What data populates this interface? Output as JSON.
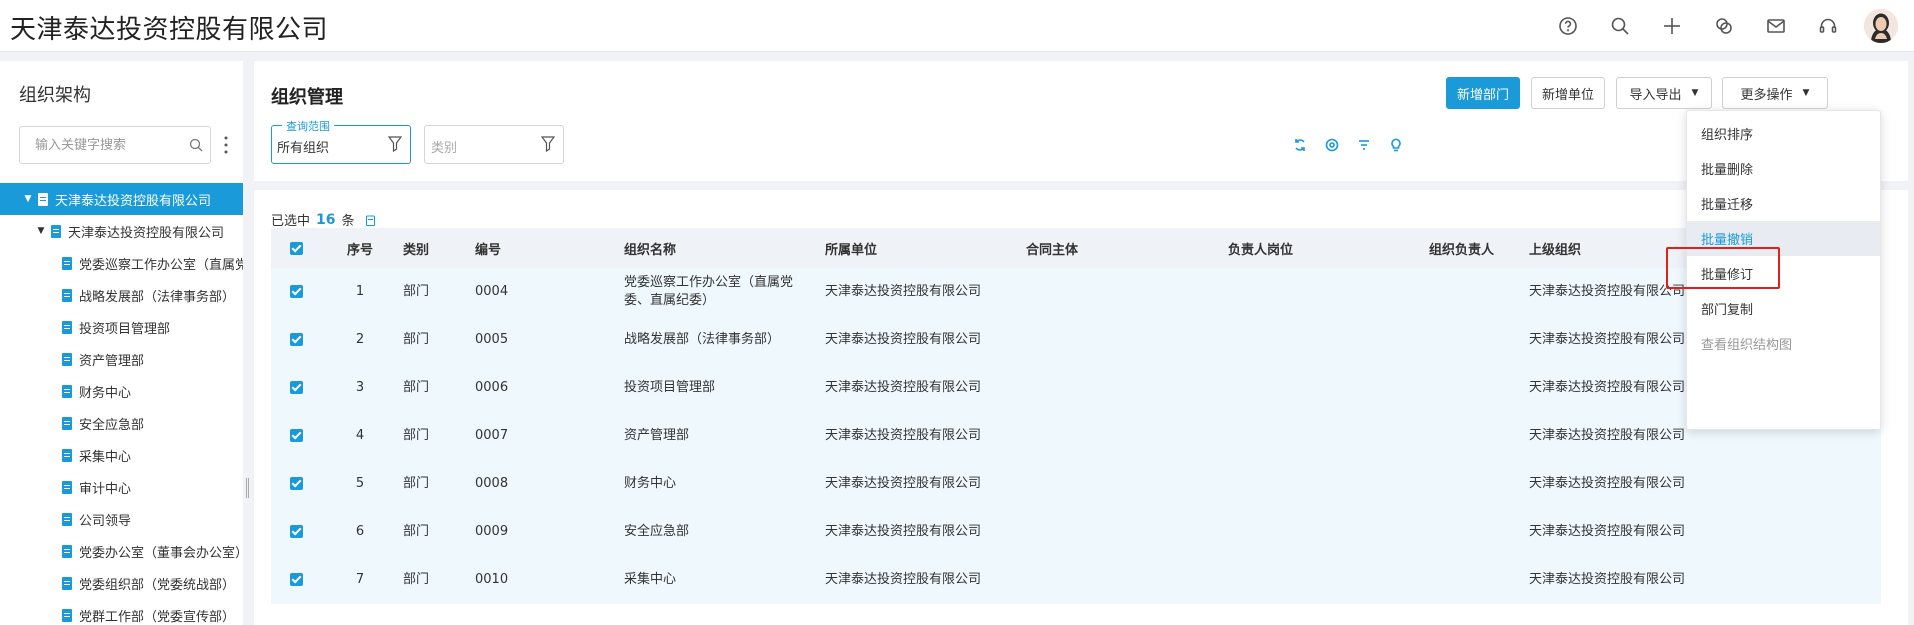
{
  "header": {
    "app_title": "天津泰达投资控股有限公司",
    "icons": [
      "help-icon",
      "search-icon",
      "plus-icon",
      "chat-icon",
      "mail-icon",
      "headset-icon"
    ]
  },
  "sidebar": {
    "title": "组织架构",
    "search_placeholder": "输入关键字搜索",
    "tree": [
      {
        "label": "天津泰达投资控股有限公司",
        "caret": "▼",
        "level": 0,
        "selected": true
      },
      {
        "label": "天津泰达投资控股有限公司",
        "caret": "▼",
        "level": 1,
        "selected": false
      },
      {
        "label": "党委巡察工作办公室（直属党委、直属纪委）",
        "caret": "",
        "level": 2,
        "selected": false
      },
      {
        "label": "战略发展部（法律事务部）",
        "caret": "",
        "level": 2,
        "selected": false
      },
      {
        "label": "投资项目管理部",
        "caret": "",
        "level": 2,
        "selected": false
      },
      {
        "label": "资产管理部",
        "caret": "",
        "level": 2,
        "selected": false
      },
      {
        "label": "财务中心",
        "caret": "",
        "level": 2,
        "selected": false
      },
      {
        "label": "安全应急部",
        "caret": "",
        "level": 2,
        "selected": false
      },
      {
        "label": "采集中心",
        "caret": "",
        "level": 2,
        "selected": false
      },
      {
        "label": "审计中心",
        "caret": "",
        "level": 2,
        "selected": false
      },
      {
        "label": "公司领导",
        "caret": "",
        "level": 2,
        "selected": false
      },
      {
        "label": "党委办公室（董事会办公室）",
        "caret": "",
        "level": 2,
        "selected": false
      },
      {
        "label": "党委组织部（党委统战部）",
        "caret": "",
        "level": 2,
        "selected": false
      },
      {
        "label": "党群工作部（党委宣传部）",
        "caret": "",
        "level": 2,
        "selected": false
      }
    ]
  },
  "main": {
    "title": "组织管理",
    "buttons": {
      "new_department": "新增部门",
      "new_unit": "新增单位",
      "import_export": "导入导出",
      "more_actions": "更多操作",
      "arrow": "▼"
    },
    "filters": {
      "scope_label": "查询范围",
      "scope_value": "所有组织",
      "category_placeholder": "类别"
    },
    "selected_prefix": "已选中",
    "selected_count": "16",
    "selected_suffix": "条",
    "table": {
      "headers": [
        "序号",
        "类别",
        "编号",
        "组织名称",
        "所属单位",
        "合同主体",
        "负责人岗位",
        "组织负责人",
        "上级组织"
      ],
      "rows": [
        {
          "seq": "1",
          "type": "部门",
          "code": "0004",
          "name": "党委巡察工作办公室（直属党委、直属纪委）",
          "unit": "天津泰达投资控股有限公司",
          "contract": "",
          "post": "",
          "leader": "",
          "parent": "天津泰达投资控股有限公司"
        },
        {
          "seq": "2",
          "type": "部门",
          "code": "0005",
          "name": "战略发展部（法律事务部）",
          "unit": "天津泰达投资控股有限公司",
          "contract": "",
          "post": "",
          "leader": "",
          "parent": "天津泰达投资控股有限公司"
        },
        {
          "seq": "3",
          "type": "部门",
          "code": "0006",
          "name": "投资项目管理部",
          "unit": "天津泰达投资控股有限公司",
          "contract": "",
          "post": "",
          "leader": "",
          "parent": "天津泰达投资控股有限公司"
        },
        {
          "seq": "4",
          "type": "部门",
          "code": "0007",
          "name": "资产管理部",
          "unit": "天津泰达投资控股有限公司",
          "contract": "",
          "post": "",
          "leader": "",
          "parent": "天津泰达投资控股有限公司"
        },
        {
          "seq": "5",
          "type": "部门",
          "code": "0008",
          "name": "财务中心",
          "unit": "天津泰达投资控股有限公司",
          "contract": "",
          "post": "",
          "leader": "",
          "parent": "天津泰达投资控股有限公司"
        },
        {
          "seq": "6",
          "type": "部门",
          "code": "0009",
          "name": "安全应急部",
          "unit": "天津泰达投资控股有限公司",
          "contract": "",
          "post": "",
          "leader": "",
          "parent": "天津泰达投资控股有限公司"
        },
        {
          "seq": "7",
          "type": "部门",
          "code": "0010",
          "name": "采集中心",
          "unit": "天津泰达投资控股有限公司",
          "contract": "",
          "post": "",
          "leader": "",
          "parent": "天津泰达投资控股有限公司"
        }
      ]
    }
  },
  "dropdown": {
    "items": [
      {
        "label": "组织排序",
        "state": "normal"
      },
      {
        "label": "批量删除",
        "state": "normal"
      },
      {
        "label": "批量迁移",
        "state": "normal"
      },
      {
        "label": "批量撤销",
        "state": "hover"
      },
      {
        "label": "批量修订",
        "state": "normal"
      },
      {
        "label": "部门复制",
        "state": "normal"
      },
      {
        "label": "查看组织结构图",
        "state": "disabled"
      }
    ]
  },
  "colors": {
    "accent": "#1a9ad8",
    "highlight_border": "#e0201a",
    "row_bg": "#eef8fd",
    "header_bg": "#eff2f6"
  }
}
